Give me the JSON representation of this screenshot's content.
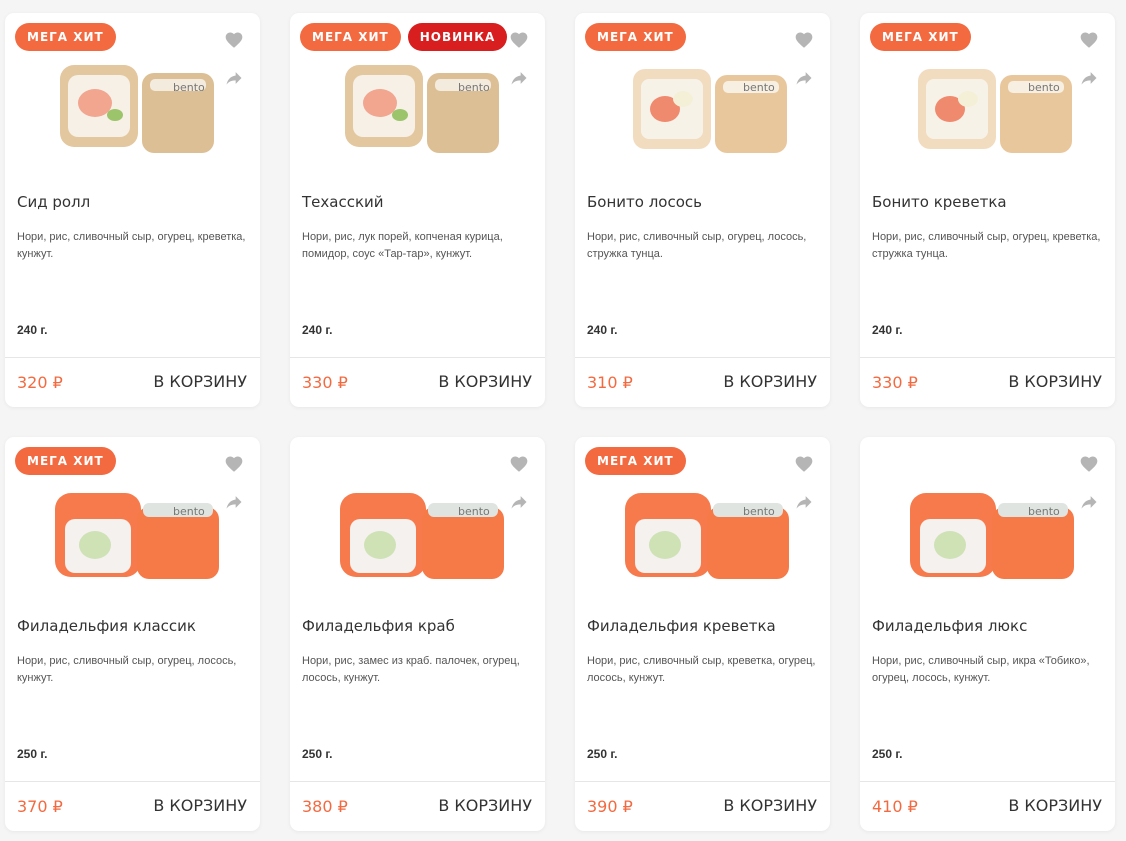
{
  "colors": {
    "accent": "#f36a40",
    "badge_hit": "#f36a40",
    "badge_new": "#d81e1e",
    "icon_gray": "#b5b5b5",
    "text": "#333333",
    "page_bg": "#f5f5f5",
    "card_bg": "#ffffff"
  },
  "labels": {
    "mega_hit": "МЕГА ХИТ",
    "new": "НОВИНКА",
    "add_to_cart": "В КОРЗИНУ"
  },
  "icons": {
    "favorite": "heart-icon",
    "share": "share-icon"
  },
  "products": [
    {
      "name": "Сид ролл",
      "description": "Нори, рис, сливочный сыр, огурец, креветка, кунжут.",
      "weight": "240 г.",
      "price": "320 ₽",
      "badges": [
        "МЕГА ХИТ"
      ],
      "image_style": "sesame",
      "image_text": "bento"
    },
    {
      "name": "Техасский",
      "description": "Нори, рис, лук порей, копченая курица, помидор, соус «Тар-тар», кунжут.",
      "weight": "240 г.",
      "price": "330 ₽",
      "badges": [
        "МЕГА ХИТ",
        "НОВИНКА"
      ],
      "image_style": "sesame",
      "image_text": "bento"
    },
    {
      "name": "Бонито лосось",
      "description": "Нори, рис, сливочный сыр, огурец, лосось, стружка тунца.",
      "weight": "240 г.",
      "price": "310 ₽",
      "badges": [
        "МЕГА ХИТ"
      ],
      "image_style": "bonito",
      "image_text": "bento"
    },
    {
      "name": "Бонито креветка",
      "description": "Нори, рис, сливочный сыр, огурец, креветка, стружка тунца.",
      "weight": "240 г.",
      "price": "330 ₽",
      "badges": [
        "МЕГА ХИТ"
      ],
      "image_style": "bonito",
      "image_text": "bento"
    },
    {
      "name": "Филадельфия классик",
      "description": "Нори, рис, сливочный сыр, огурец, лосось, кунжут.",
      "weight": "250 г.",
      "price": "370 ₽",
      "badges": [
        "МЕГА ХИТ"
      ],
      "image_style": "salmon",
      "image_text": "bento"
    },
    {
      "name": "Филадельфия краб",
      "description": "Нори, рис, замес из краб. палочек, огурец, лосось, кунжут.",
      "weight": "250 г.",
      "price": "380 ₽",
      "badges": [],
      "image_style": "salmon",
      "image_text": "bento"
    },
    {
      "name": "Филадельфия креветка",
      "description": "Нори, рис, сливочный сыр, креветка, огурец, лосось, кунжут.",
      "weight": "250 г.",
      "price": "390 ₽",
      "badges": [
        "МЕГА ХИТ"
      ],
      "image_style": "salmon",
      "image_text": "bento"
    },
    {
      "name": "Филадельфия люкс",
      "description": "Нори, рис, сливочный сыр, икра «Тобико», огурец, лосось, кунжут.",
      "weight": "250 г.",
      "price": "410 ₽",
      "badges": [],
      "image_style": "salmon",
      "image_text": "bento"
    }
  ]
}
